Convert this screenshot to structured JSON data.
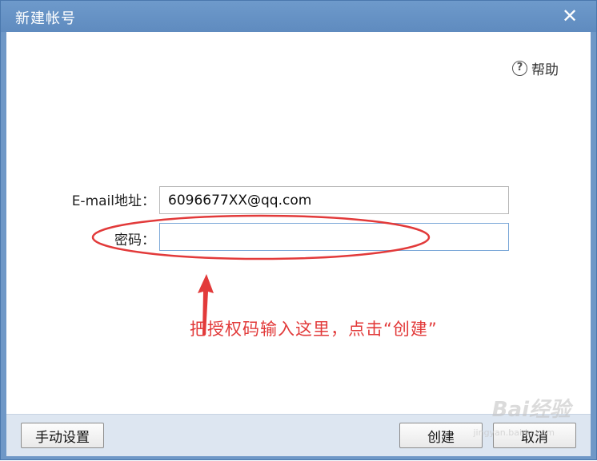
{
  "window": {
    "title": "新建帐号",
    "close_icon": "close-icon"
  },
  "help": {
    "label": "帮助",
    "icon": "help-circle-icon",
    "glyph": "?"
  },
  "form": {
    "email_label": "E-mail地址：",
    "email_value": "6096677XX@qq.com",
    "password_label": "密码：",
    "password_value": ""
  },
  "annotation": {
    "text": "把授权码输入这里，点击“创建”",
    "color": "#e23a3a"
  },
  "footer": {
    "manual_settings_label": "手动设置",
    "create_label": "创建",
    "cancel_label": "取消"
  },
  "watermark": {
    "text": "Bai经验",
    "sub": "jingyan.baidu.com"
  }
}
